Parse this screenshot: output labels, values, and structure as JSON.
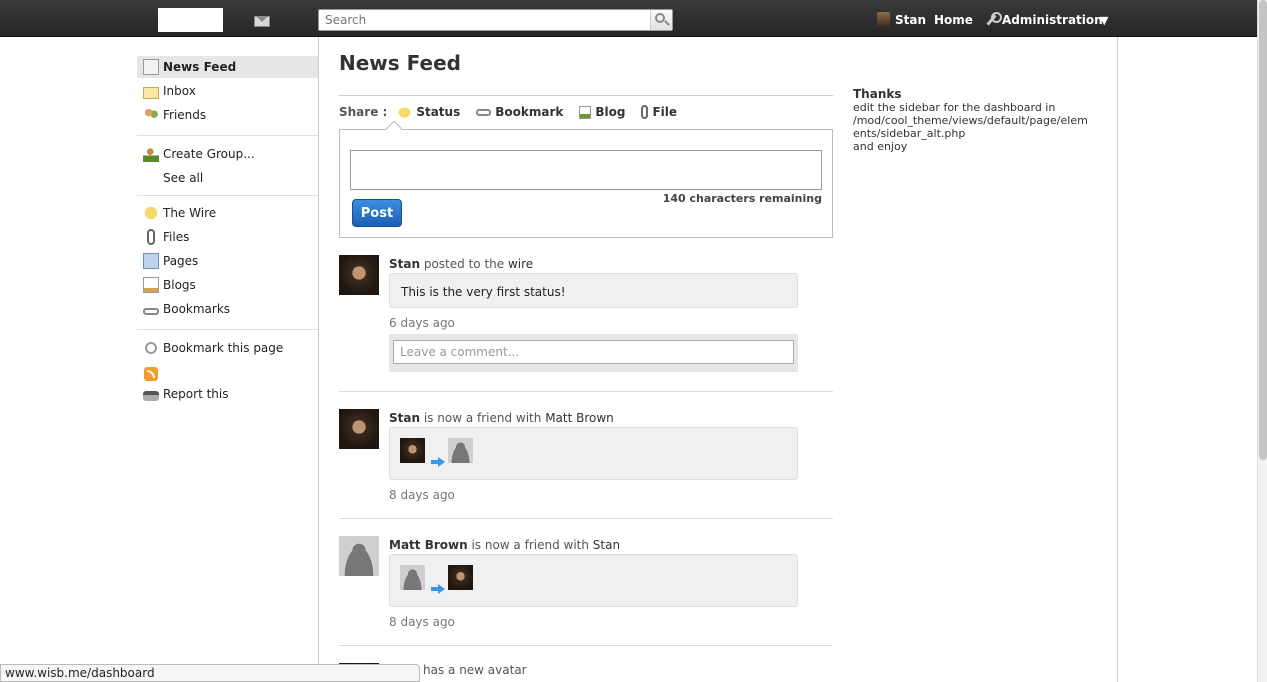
{
  "topbar": {
    "search_placeholder": "Search",
    "user": "Stan",
    "home": "Home",
    "admin": "Administration",
    "caret": "▼"
  },
  "sidebar": {
    "items": [
      {
        "label": "News Feed"
      },
      {
        "label": "Inbox"
      },
      {
        "label": "Friends"
      },
      {
        "label": "Create Group..."
      },
      {
        "label": "See all"
      },
      {
        "label": "The Wire"
      },
      {
        "label": "Files"
      },
      {
        "label": "Pages"
      },
      {
        "label": "Blogs"
      },
      {
        "label": "Bookmarks"
      },
      {
        "label": "Bookmark this page"
      },
      {
        "label": "Report this"
      }
    ]
  },
  "main": {
    "title": "News Feed",
    "share_label": "Share :",
    "share_tabs": [
      "Status",
      "Bookmark",
      "Blog",
      "File"
    ],
    "chars_remaining": "140 characters remaining",
    "post_button": "Post"
  },
  "feed": [
    {
      "user": "Stan",
      "action": " posted to the ",
      "target": "wire",
      "text": "This is the very first status!",
      "time": "6 days ago",
      "comment_placeholder": "Leave a comment..."
    },
    {
      "user": "Stan",
      "action": " is now a friend with ",
      "target": "Matt Brown",
      "time": "8 days ago"
    },
    {
      "user": "Matt Brown",
      "action": " is now a friend with ",
      "target": "Stan",
      "time": "8 days ago"
    },
    {
      "action": "has a new avatar"
    }
  ],
  "right_sidebar": {
    "title": "Thanks",
    "line1": "edit the sidebar for the dashboard in",
    "line2": "/mod/cool_theme/views/default/page/elem",
    "line3": "ents/sidebar_alt.php",
    "line4": "and enjoy"
  },
  "statusbar": {
    "url": "www.wisb.me/dashboard"
  },
  "colors": {
    "topbar": "#2e2e2e",
    "post_button": "#1a5fb4",
    "active_menu": "#e6e6e6"
  }
}
